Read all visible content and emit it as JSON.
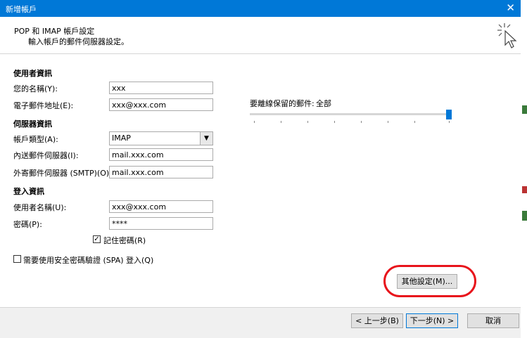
{
  "window": {
    "title": "新增帳戶",
    "close_glyph": "✕"
  },
  "header": {
    "title": "POP 和 IMAP 帳戶設定",
    "subtitle": "輸入帳戶的郵件伺服器設定。"
  },
  "user_info": {
    "heading": "使用者資訊",
    "name_label": "您的名稱(Y):",
    "name_value": "xxx",
    "email_label": "電子郵件地址(E):",
    "email_value": "xxx@xxx.com"
  },
  "server_info": {
    "heading": "伺服器資訊",
    "account_type_label": "帳戶類型(A):",
    "account_type_value": "IMAP",
    "incoming_label": "內送郵件伺服器(I):",
    "incoming_value": "mail.xxx.com",
    "outgoing_label": "外寄郵件伺服器 (SMTP)(O):",
    "outgoing_value": "mail.xxx.com"
  },
  "login_info": {
    "heading": "登入資訊",
    "username_label": "使用者名稱(U):",
    "username_value": "xxx@xxx.com",
    "password_label": "密碼(P):",
    "password_value": "****",
    "remember_label": "記住密碼(R)",
    "remember_checked": true
  },
  "spa": {
    "label": "需要使用安全密碼驗證 (SPA) 登入(Q)",
    "checked": false
  },
  "offline": {
    "label": "要離線保留的郵件:",
    "value_label": "全部",
    "level_percent": 100
  },
  "buttons": {
    "more_settings": "其他設定(M)...",
    "back": "< 上一步(B)",
    "next": "下一步(N) >",
    "cancel": "取消"
  },
  "colors": {
    "titlebar": "#0078d7",
    "accent": "#0078d7",
    "highlight_ring": "#e8141b"
  },
  "icons": {
    "dropdown": "chevron-down-icon",
    "header_graphic": "magic-wand-cursor-icon"
  }
}
